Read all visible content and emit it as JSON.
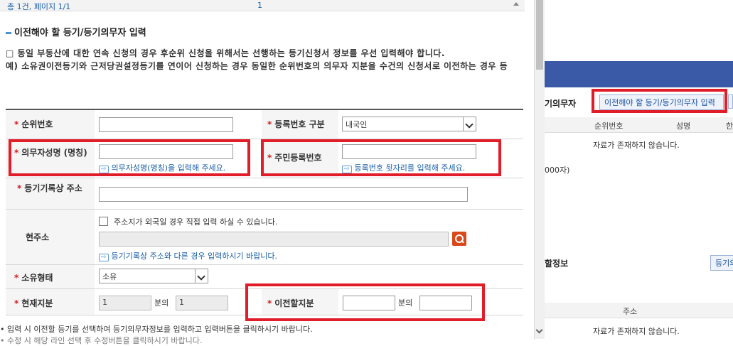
{
  "top": {
    "total": "총 1건, 페이지 1/1",
    "page": "1"
  },
  "section": {
    "title": "이전해야 할 등기/등기의무자 입력"
  },
  "notice": {
    "line1": "□ 동일 부동산에 대한 연속 신청의 경우 후순위 신청을 위해서는 선행하는 등기신청서 정보를 우선 입력해야 합니다.",
    "line2": "예) 소유권이전등기와 근저당권설정등기를 연이어 신청하는 경우 동일한 순위번호의 의무자 지분을 수건의 신청서로 이전하는 경우 등"
  },
  "form": {
    "rank_label": "순위번호",
    "rank_value": "",
    "regnum_type_label": "등록번호 구분",
    "regnum_type_value": "내국인",
    "obligor_name_label": "의무자성명 (명칭)",
    "obligor_name_value": "",
    "obligor_name_hint": "의무자성명(명칭)을 입력해 주세요.",
    "resident_label": "주민등록번호",
    "resident_value": "",
    "resident_hint": "등록번호 뒷자리를 입력해 주세요.",
    "reg_addr_label": "등기기록상 주소",
    "reg_addr_value": "",
    "cur_addr_label": "현주소",
    "foreign_checkbox_text": "주소지가 외국일 경우 직접 입력 하실 수 있습니다.",
    "cur_addr_hint": "등기기록상 주소와 다른 경우 입력하시기 바랍니다.",
    "ownership_label": "소유형태",
    "ownership_value": "소유",
    "cur_share_label": "현재지분",
    "cur_share_num": "1",
    "cur_share_of": "분의",
    "cur_share_den": "1",
    "transfer_share_label": "이전할지분",
    "transfer_share_of": "분의"
  },
  "bottom": {
    "line1": "• 입력 시 이전할 등기를 선택하여 등기의무자정보를 입력하고 입력버튼을 클릭하시기 바랍니다.",
    "line2": "• 수정 시 해당 라인 선택 후 수정버튼을 클릭하시기 바랍니다."
  },
  "right_panel": {
    "label": "기의무자",
    "button": "이전해야 할 등기/등기의무자 입력",
    "col1": "순위번호",
    "col2": "성명",
    "col3": "한",
    "empty1": "자료가 존재하지 않습니다.",
    "char_limit": "000자)",
    "info_label": "할정보",
    "btn2": "등기의",
    "addr_col": "주소",
    "empty2": "자료가 존재하지 않습니다."
  },
  "colors": {
    "highlight": "#e11d2a",
    "accent": "#1b5fa8",
    "required": "#d51b1b"
  }
}
